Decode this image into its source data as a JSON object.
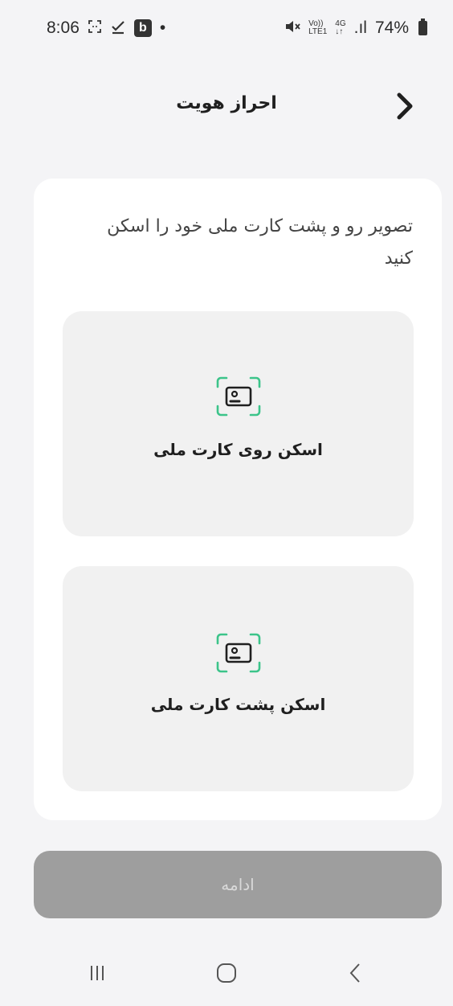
{
  "status_bar": {
    "time": "8:06",
    "app_badge": "b",
    "dot": "•",
    "network_top": "Vo))",
    "network_bottom": "LTE1",
    "gen_top": "4G",
    "gen_bottom": "↓↑",
    "signal": ".ıl",
    "battery": "74%"
  },
  "header": {
    "title": "احراز هویت",
    "back_icon": "chevron-right-icon"
  },
  "card": {
    "instruction": "تصویر رو و پشت کارت ملی خود را اسکن کنید",
    "scan_front_label": "اسکن روی کارت ملی",
    "scan_back_label": "اسکن پشت کارت ملی",
    "scan_icon": "id-card-scan-icon"
  },
  "continue_label": "ادامه",
  "colors": {
    "accent": "#3cc48a",
    "button_disabled": "#9e9e9e",
    "background": "#f4f4f6"
  }
}
